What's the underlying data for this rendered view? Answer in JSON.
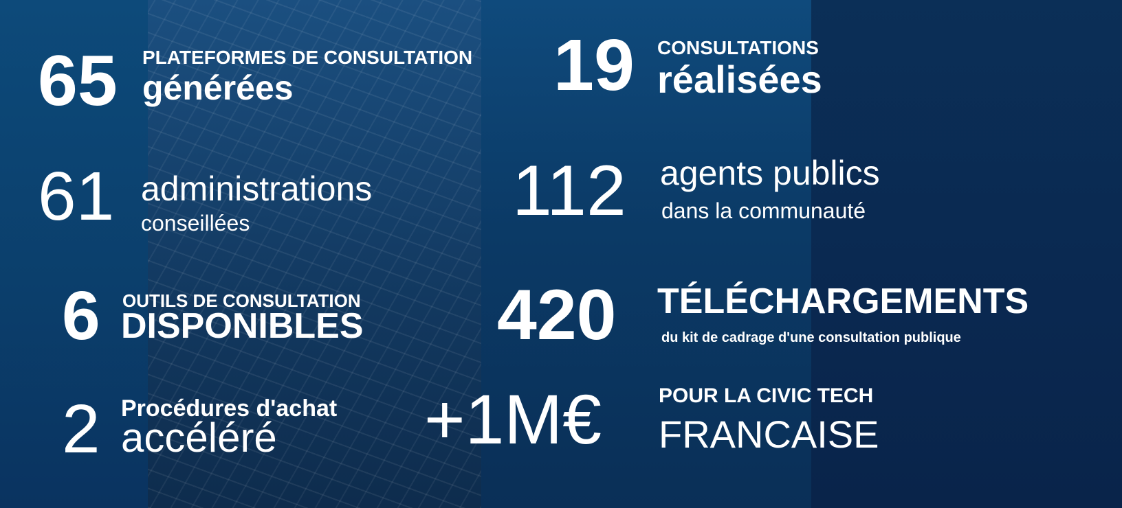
{
  "stats": [
    {
      "number": "65",
      "line1": "PLATEFORMES DE CONSULTATION",
      "line2": "générées"
    },
    {
      "number": "19",
      "line1": "CONSULTATIONS",
      "line2": "réalisées"
    },
    {
      "number": "61",
      "line1": "administrations",
      "line2": "conseillées"
    },
    {
      "number": "112",
      "line1": "agents publics",
      "line2": "dans la communauté"
    },
    {
      "number": "6",
      "line1": "OUTILS DE CONSULTATION",
      "line2": "DISPONIBLES"
    },
    {
      "number": "420",
      "line1": "TÉLÉCHARGEMENTS",
      "line2": "du kit de cadrage d'une consultation publique"
    },
    {
      "number": "2",
      "line1": "Procédures d'achat",
      "line2": "accéléré"
    },
    {
      "number": "+1M€",
      "line1": "POUR LA CIVIC TECH",
      "line2": "FRANCAISE"
    }
  ],
  "colors": {
    "text": "#ffffff",
    "background": "#0b3560"
  }
}
